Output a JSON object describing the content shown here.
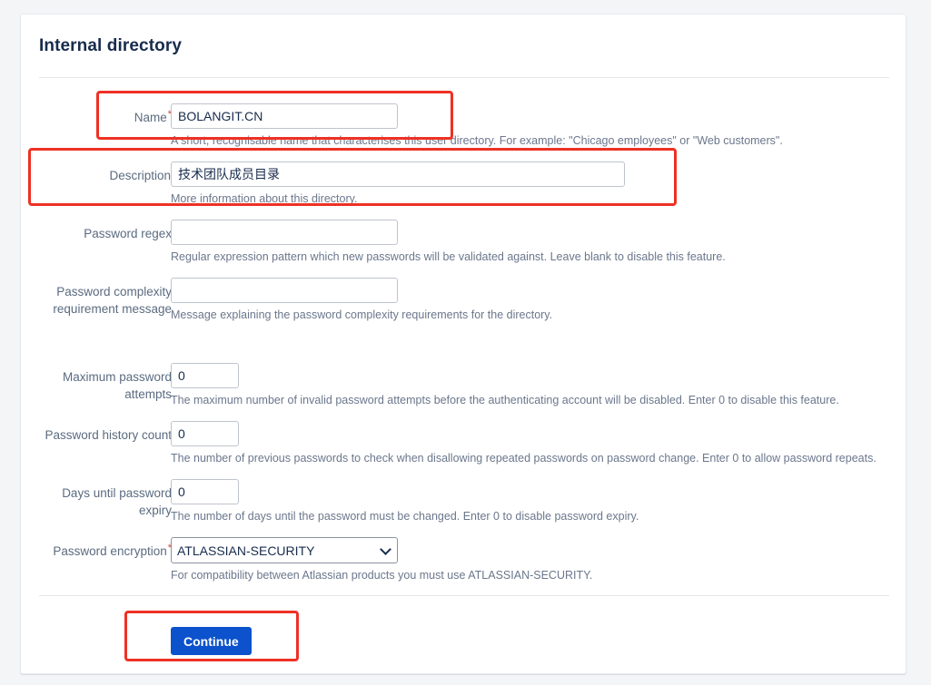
{
  "page": {
    "title": "Internal directory",
    "background_color": "#f4f5f7",
    "card_color": "#ffffff"
  },
  "theme": {
    "accent_blue": "#0b52cc",
    "label_gray": "#5b6b80",
    "help_gray": "#6b778c",
    "required_red": "#d04437",
    "highlight_red": "#ee3124",
    "title_navy": "#172b4d"
  },
  "form": {
    "fields": [
      {
        "id": "name",
        "label": "Name",
        "required": true,
        "required_marker": "*",
        "value": "BOLANGIT.CN",
        "placeholder": "",
        "help": "A short, recognisable name that characterises this user directory. For example: \"Chicago employees\" or \"Web customers\"."
      },
      {
        "id": "description",
        "label": "Description",
        "required": false,
        "required_marker": "",
        "value": "技术团队成员目录",
        "placeholder": "",
        "help": "More information about this directory."
      },
      {
        "id": "password-regex",
        "label": "Password regex",
        "required": false,
        "required_marker": "",
        "value": "",
        "placeholder": "",
        "help": "Regular expression pattern which new passwords will be validated against. Leave blank to disable this feature."
      },
      {
        "id": "password-complexity-requirement-message",
        "label": "Password complexity requirement message",
        "required": false,
        "required_marker": "",
        "value": "",
        "placeholder": "",
        "help": "Message explaining the password complexity requirements for the directory."
      },
      {
        "id": "maximum-password-attempts",
        "label": "Maximum password attempts",
        "required": false,
        "required_marker": "",
        "value": "0",
        "placeholder": "",
        "help": "The maximum number of invalid password attempts before the authenticating account will be disabled. Enter 0 to disable this feature."
      },
      {
        "id": "password-history-count",
        "label": "Password history count",
        "required": false,
        "required_marker": "",
        "value": "0",
        "placeholder": "",
        "help": "The number of previous passwords to check when disallowing repeated passwords on password change. Enter 0 to allow password repeats."
      },
      {
        "id": "days-until-password-expiry",
        "label": "Days until password expiry",
        "required": false,
        "required_marker": "",
        "value": "0",
        "placeholder": "",
        "help": "The number of days until the password must be changed. Enter 0 to disable password expiry."
      },
      {
        "id": "password-encryption",
        "label": "Password encryption",
        "required": true,
        "required_marker": "*",
        "value": "ATLASSIAN-SECURITY",
        "options": [
          "ATLASSIAN-SECURITY"
        ],
        "help": "For compatibility between Atlassian products you must use ATLASSIAN-SECURITY."
      }
    ],
    "submit_label": "Continue"
  },
  "annotations": {
    "highlight_name": "Name field highlighted",
    "highlight_description": "Description field highlighted",
    "highlight_continue": "Continue button highlighted"
  }
}
